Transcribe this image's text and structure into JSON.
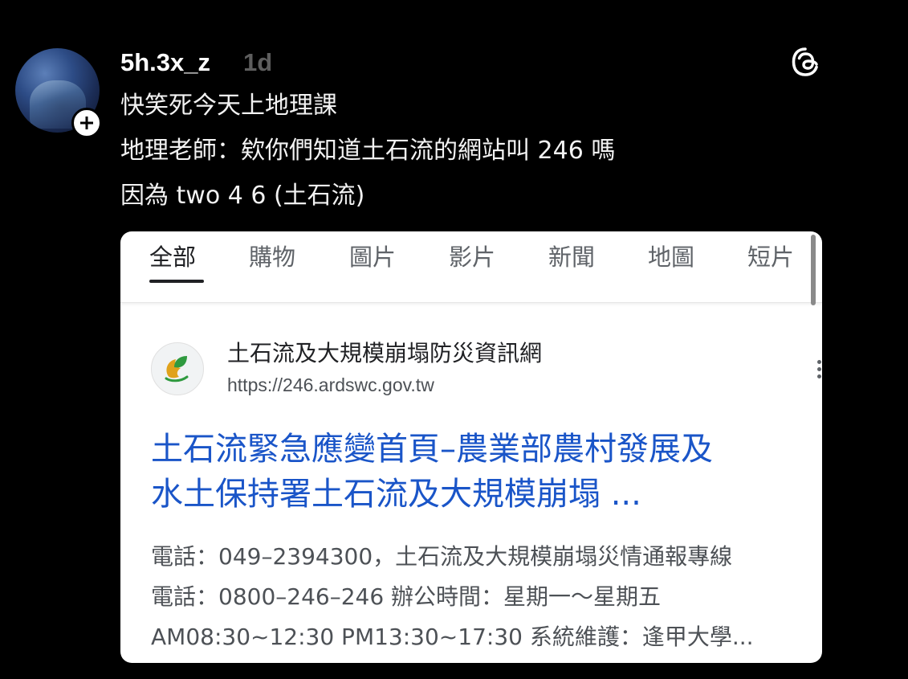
{
  "post": {
    "username": "5h.3x_z",
    "timestamp": "1d",
    "lines": [
      "快笑死今天上地理課",
      "地理老師：欸你們知道土石流的網站叫 246 嗎",
      "因為 two 4 6 (土石流)"
    ],
    "icons": {
      "avatar": "profile-avatar",
      "follow": "plus-icon",
      "app": "threads-logo-icon"
    }
  },
  "screenshot": {
    "tabs": [
      "全部",
      "購物",
      "圖片",
      "影片",
      "新聞",
      "地圖",
      "短片"
    ],
    "active_tab": "全部",
    "result": {
      "site_name": "土石流及大規模崩塌防災資訊網",
      "url": "https://246.ardswc.gov.tw",
      "title_lines": [
        "土石流緊急應變首頁–農業部農村發展及",
        "水土保持署土石流及大規模崩塌 ..."
      ],
      "snippet_lines": [
        "電話：049–2394300，土石流及大規模崩塌災情通報專線",
        "電話：0800–246–246 辦公時間：星期一～星期五",
        "AM08:30~12:30 PM13:30~17:30 系統維護：逢甲大學..."
      ]
    },
    "colors": {
      "link": "#1a55c8",
      "snippet": "#4d5156",
      "background": "#000000",
      "card": "#ffffff"
    }
  }
}
